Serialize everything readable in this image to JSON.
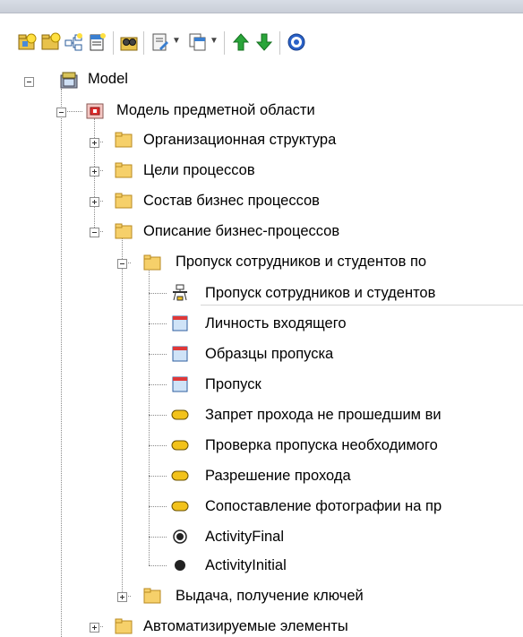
{
  "toolbar": {
    "buttons": [
      "new-package-icon",
      "new-view-icon",
      "new-diagram-icon",
      "new-element-icon",
      "find-icon",
      "document-icon",
      "copy-icon",
      "move-up-icon",
      "move-down-icon",
      "help-icon"
    ]
  },
  "tree": {
    "root": "Model",
    "domain_model": "Модель предметной области",
    "org_structure": "Организационная структура",
    "process_goals": "Цели процессов",
    "process_composition": "Состав бизнес процессов",
    "process_description": "Описание бизнес-процессов",
    "pass_package": "Пропуск сотрудников и студентов по",
    "pass_diagram": "Пропуск сотрудников и студентов",
    "pass_children": [
      {
        "label": "Личность входящего",
        "icon": "object-icon"
      },
      {
        "label": "Образцы пропуска",
        "icon": "object-icon"
      },
      {
        "label": "Пропуск",
        "icon": "object-icon"
      },
      {
        "label": "Запрет прохода не прошедшим ви",
        "icon": "activity-icon"
      },
      {
        "label": "Проверка пропуска необходимого",
        "icon": "activity-icon"
      },
      {
        "label": "Разрешение прохода",
        "icon": "activity-icon"
      },
      {
        "label": "Сопоставление фотографии на пр",
        "icon": "activity-icon"
      },
      {
        "label": "ActivityFinal",
        "icon": "activity-final-icon"
      },
      {
        "label": "ActivityInitial",
        "icon": "activity-initial-icon"
      }
    ],
    "keys_package": "Выдача, получение ключей",
    "automated_elements": "Автоматизируемые элементы"
  }
}
